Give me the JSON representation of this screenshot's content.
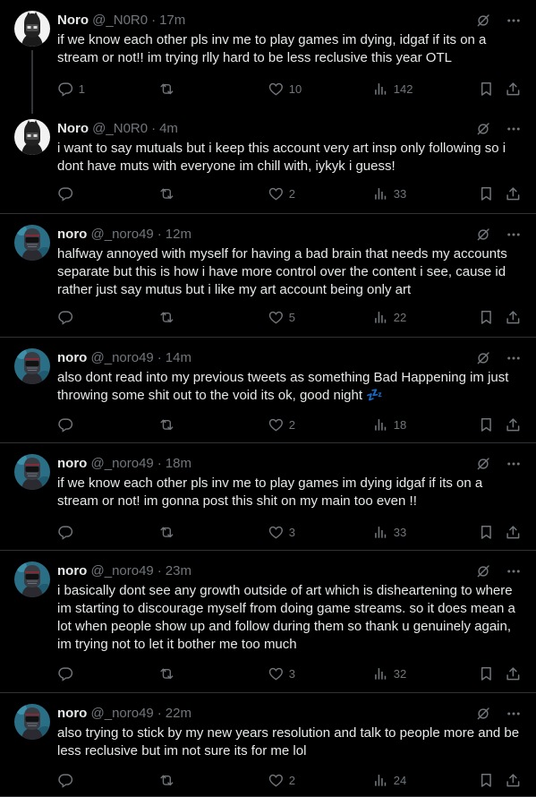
{
  "tweets": [
    {
      "name": "Noro",
      "handle": "@_N0R0",
      "time": "17m",
      "avatar": "white-masked",
      "text": "if we know each other pls inv me to play games im dying, idgaf if its on a stream or not!! im trying rlly hard to be less reclusive this year OTL",
      "replies": "1",
      "retweets": "",
      "likes": "10",
      "views": "142"
    },
    {
      "name": "Noro",
      "handle": "@_N0R0",
      "time": "4m",
      "avatar": "white-masked",
      "text": "i want to say mutuals but i keep this account very art insp only following so i dont have muts with everyone im chill with, iykyk i guess!",
      "replies": "",
      "retweets": "",
      "likes": "2",
      "views": "33"
    },
    {
      "name": "noro",
      "handle": "@_noro49",
      "time": "12m",
      "avatar": "teal-helmet",
      "text": "halfway annoyed with myself for having a bad brain that needs my accounts separate but this is how i have more control over the content i see, cause id rather just say mutus but i like my art account being only art",
      "replies": "",
      "retweets": "",
      "likes": "5",
      "views": "22"
    },
    {
      "name": "noro",
      "handle": "@_noro49",
      "time": "14m",
      "avatar": "teal-helmet",
      "text": "also dont read into my previous tweets as something Bad Happening im just throwing some shit out to the void its ok, good night 💤",
      "replies": "",
      "retweets": "",
      "likes": "2",
      "views": "18"
    },
    {
      "name": "noro",
      "handle": "@_noro49",
      "time": "18m",
      "avatar": "teal-helmet",
      "text": "if we know each other pls inv me to play games im dying idgaf if its on a stream or not! im gonna post this shit on my main too even !!",
      "replies": "",
      "retweets": "",
      "likes": "3",
      "views": "33"
    },
    {
      "name": "noro",
      "handle": "@_noro49",
      "time": "23m",
      "avatar": "teal-helmet",
      "text": "i basically dont see any growth outside of art which is disheartening to where im starting to discourage myself from doing game streams. so it does mean a lot when people show up and follow during them so thank u genuinely again, im trying not to let it bother me too much",
      "replies": "",
      "retweets": "",
      "likes": "3",
      "views": "32"
    },
    {
      "name": "noro",
      "handle": "@_noro49",
      "time": "22m",
      "avatar": "teal-helmet",
      "text": "also trying to stick by my new years resolution and talk to people more and be less reclusive but im not sure its for me lol",
      "replies": "",
      "retweets": "",
      "likes": "2",
      "views": "24"
    }
  ],
  "colors": {
    "background": "#000000",
    "text": "#e7e9ea",
    "muted": "#71767b",
    "divider": "#2f3336"
  }
}
